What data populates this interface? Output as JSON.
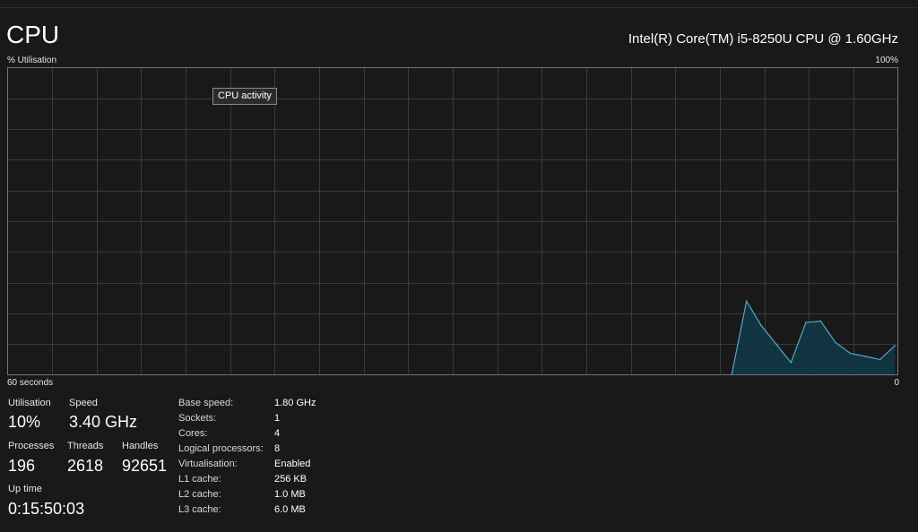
{
  "header": {
    "title": "CPU",
    "cpu_model": "Intel(R) Core(TM) i5-8250U CPU @ 1.60GHz"
  },
  "graph": {
    "y_label": "% Utilisation",
    "y_max_label": "100%",
    "x_left_label": "60 seconds",
    "x_right_label": "0",
    "tooltip": "CPU activity",
    "line_color": "#4ea9c9",
    "fill_color": "#0f3946",
    "grid_color": "#3a3a3a",
    "border_color": "#757575"
  },
  "chart_data": {
    "type": "area",
    "title": "",
    "xlabel": "",
    "ylabel": "% Utilisation",
    "xlim": [
      60,
      0
    ],
    "ylim": [
      0,
      100
    ],
    "grid": true,
    "series": [
      {
        "values": [
          {
            "x": 11.2,
            "y": 0
          },
          {
            "x": 10.2,
            "y": 24
          },
          {
            "x": 9.2,
            "y": 16
          },
          {
            "x": 8.2,
            "y": 10
          },
          {
            "x": 7.2,
            "y": 4
          },
          {
            "x": 6.2,
            "y": 17
          },
          {
            "x": 5.2,
            "y": 17.5
          },
          {
            "x": 4.2,
            "y": 10.5
          },
          {
            "x": 3.2,
            "y": 7
          },
          {
            "x": 2.2,
            "y": 6
          },
          {
            "x": 1.2,
            "y": 5
          },
          {
            "x": 0.2,
            "y": 9.5
          }
        ]
      }
    ]
  },
  "stats": {
    "utilisation": {
      "label": "Utilisation",
      "value": "10%"
    },
    "speed": {
      "label": "Speed",
      "value": "3.40 GHz"
    },
    "processes": {
      "label": "Processes",
      "value": "196"
    },
    "threads": {
      "label": "Threads",
      "value": "2618"
    },
    "handles": {
      "label": "Handles",
      "value": "92651"
    },
    "uptime": {
      "label": "Up time",
      "value": "0:15:50:03"
    }
  },
  "details": [
    {
      "label": "Base speed:",
      "value": "1.80 GHz"
    },
    {
      "label": "Sockets:",
      "value": "1"
    },
    {
      "label": "Cores:",
      "value": "4"
    },
    {
      "label": "Logical processors:",
      "value": "8"
    },
    {
      "label": "Virtualisation:",
      "value": "Enabled"
    },
    {
      "label": "L1 cache:",
      "value": "256 KB"
    },
    {
      "label": "L2 cache:",
      "value": "1.0 MB"
    },
    {
      "label": "L3 cache:",
      "value": "6.0 MB"
    }
  ]
}
